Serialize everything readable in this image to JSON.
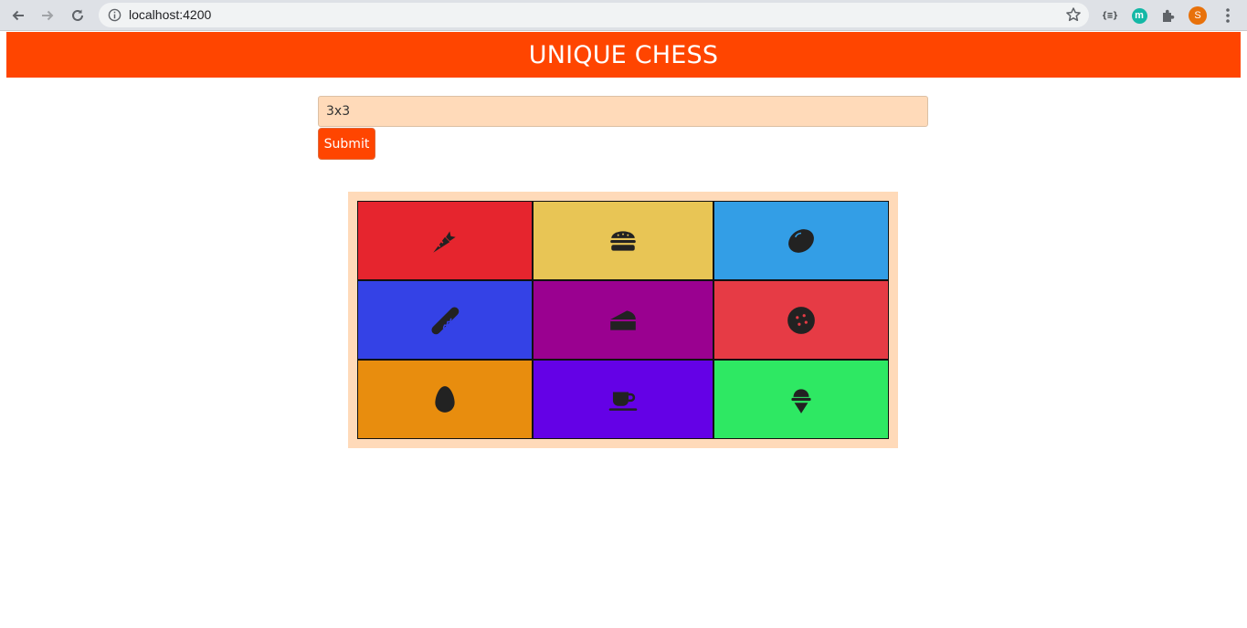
{
  "browser": {
    "url": "localhost:4200",
    "profile_initial": "S",
    "extension_json_label": "{≡}",
    "extension_m_label": "m"
  },
  "page": {
    "title": "UNIQUE CHESS",
    "input_value": "3x3",
    "submit_label": "Submit",
    "accent_color": "#ff4500",
    "panel_color": "#ffdab9"
  },
  "board": {
    "size": "3x3",
    "cells": [
      {
        "color": "#e6252e",
        "icon": "carrot-icon"
      },
      {
        "color": "#e8c555",
        "icon": "hamburger-icon"
      },
      {
        "color": "#339ee6",
        "icon": "lemon-icon"
      },
      {
        "color": "#3442e6",
        "icon": "hotdog-icon"
      },
      {
        "color": "#9a0190",
        "icon": "cheese-icon"
      },
      {
        "color": "#e63b45",
        "icon": "cookie-icon"
      },
      {
        "color": "#e88d0e",
        "icon": "egg-icon"
      },
      {
        "color": "#6401e6",
        "icon": "coffee-icon"
      },
      {
        "color": "#2ee863",
        "icon": "ice-cream-icon"
      }
    ]
  }
}
